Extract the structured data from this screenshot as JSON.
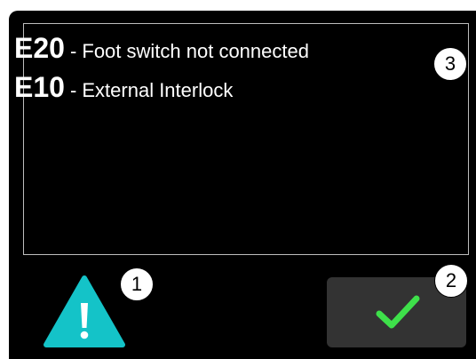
{
  "errors": [
    {
      "code": "E20",
      "description": "- Foot switch not connected"
    },
    {
      "code": "E10",
      "description": "- External Interlock"
    }
  ],
  "callouts": {
    "panel": "3",
    "warning": "1",
    "confirm": "2"
  },
  "icons": {
    "warning": "warning-triangle-icon",
    "confirm": "checkmark-icon"
  },
  "colors": {
    "background": "#000000",
    "panel_border": "#bdbdbd",
    "warning": "#14c3c8",
    "button": "#333333",
    "check": "#3ee04a",
    "text": "#ffffff"
  }
}
